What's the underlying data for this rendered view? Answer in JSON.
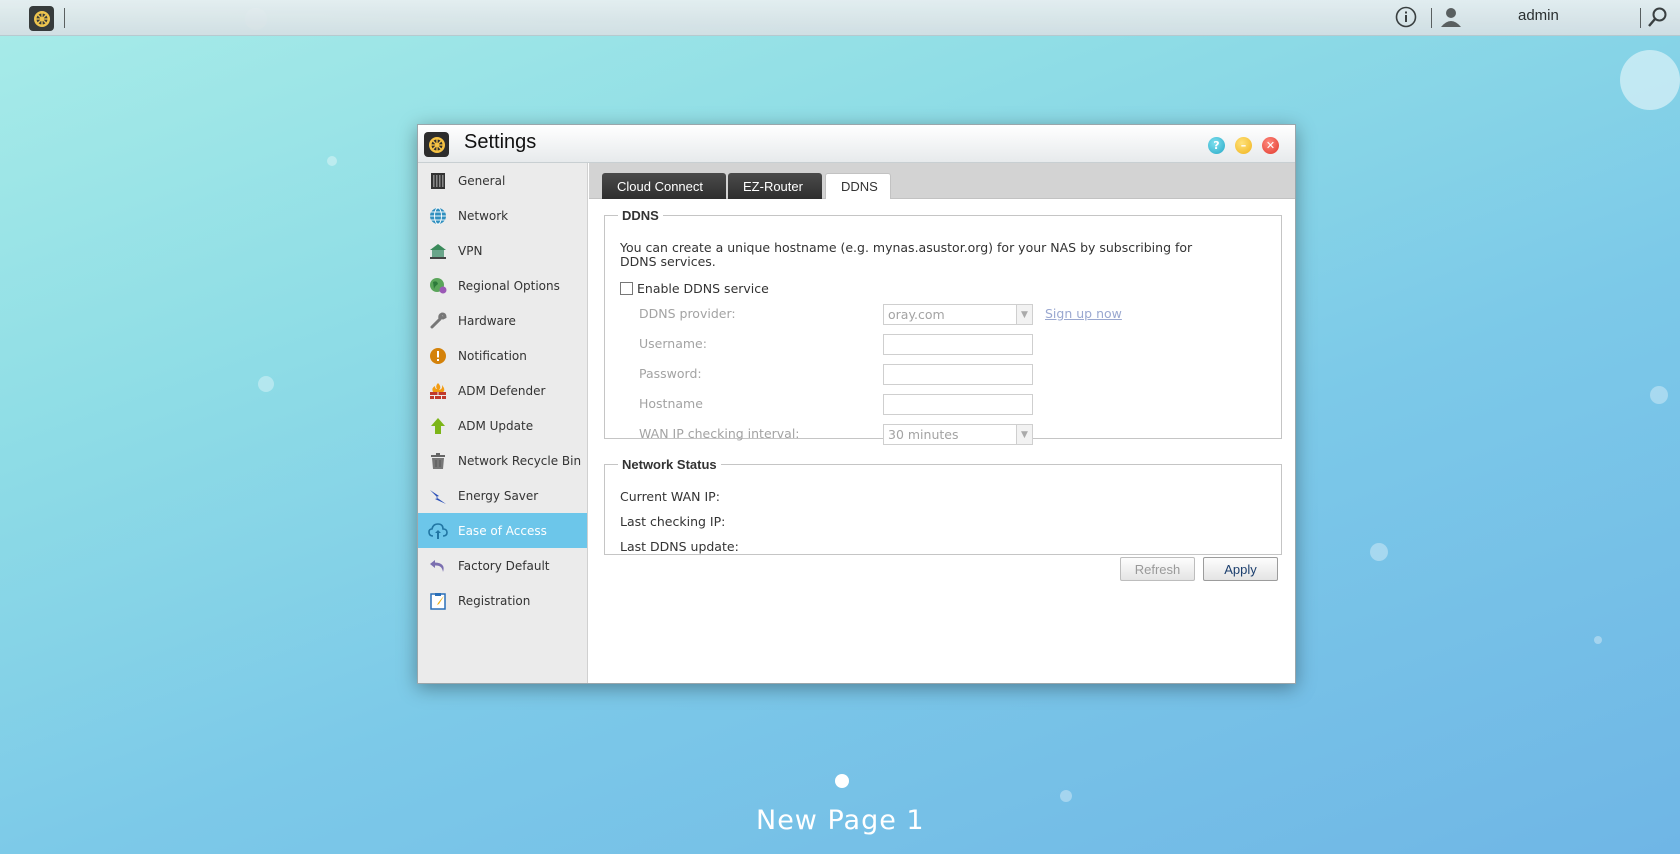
{
  "topbar": {
    "username": "admin"
  },
  "window": {
    "title": "Settings"
  },
  "sidebar": {
    "items": [
      {
        "label": "General",
        "icon": "nas-icon"
      },
      {
        "label": "Network",
        "icon": "globe-icon"
      },
      {
        "label": "VPN",
        "icon": "vpn-house-icon"
      },
      {
        "label": "Regional Options",
        "icon": "region-globe-icon"
      },
      {
        "label": "Hardware",
        "icon": "wrench-icon"
      },
      {
        "label": "Notification",
        "icon": "alert-icon"
      },
      {
        "label": "ADM Defender",
        "icon": "firewall-icon"
      },
      {
        "label": "ADM Update",
        "icon": "up-arrow-icon"
      },
      {
        "label": "Network Recycle Bin",
        "icon": "trash-icon"
      },
      {
        "label": "Energy Saver",
        "icon": "lightning-icon"
      },
      {
        "label": "Ease of Access",
        "icon": "cloud-upload-icon"
      },
      {
        "label": "Factory Default",
        "icon": "undo-icon"
      },
      {
        "label": "Registration",
        "icon": "clipboard-icon"
      }
    ],
    "active_index": 10
  },
  "tabs": [
    {
      "label": "Cloud Connect"
    },
    {
      "label": "EZ-Router"
    },
    {
      "label": "DDNS"
    }
  ],
  "ddns": {
    "legend": "DDNS",
    "description": "You can create a unique hostname (e.g. mynas.asustor.org) for your NAS by subscribing for DDNS services.",
    "enable_label": "Enable DDNS service",
    "enable_checked": false,
    "provider_label": "DDNS provider:",
    "provider_value": "oray.com",
    "signup_link": "Sign up now",
    "username_label": "Username:",
    "username_value": "",
    "password_label": "Password:",
    "password_value": "",
    "hostname_label": "Hostname",
    "hostname_value": "",
    "interval_label": "WAN IP checking interval:",
    "interval_value": "30 minutes"
  },
  "status": {
    "legend": "Network Status",
    "wan_ip_label": "Current WAN IP:",
    "last_check_label": "Last checking IP:",
    "last_update_label": "Last DDNS update:"
  },
  "buttons": {
    "refresh": "Refresh",
    "apply": "Apply"
  },
  "desktop": {
    "page_label": "New Page 1"
  }
}
